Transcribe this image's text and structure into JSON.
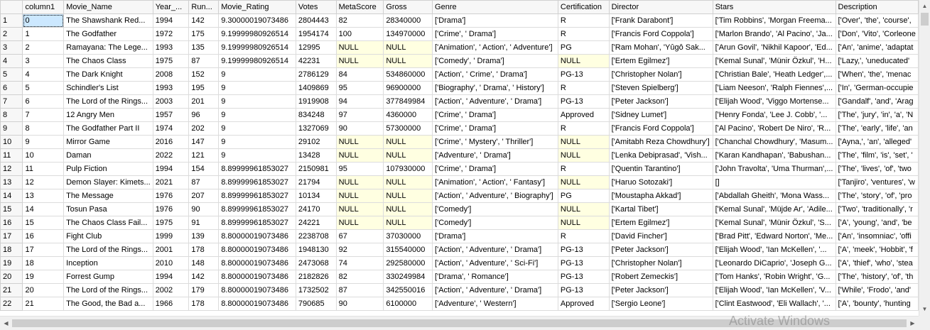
{
  "columns": [
    "",
    "column1",
    "Movie_Name",
    "Year_...",
    "Run...",
    "Movie_Rating",
    "Votes",
    "MetaScore",
    "Gross",
    "Genre",
    "Certification",
    "Director",
    "Stars",
    "Description"
  ],
  "rows": [
    [
      "1",
      "0",
      "The Shawshank Red...",
      "1994",
      "142",
      "9.30000019073486",
      "2804443",
      "82",
      "28340000",
      "['Drama']",
      "R",
      "['Frank Darabont']",
      "['Tim Robbins', 'Morgan Freema...",
      "['Over', 'the', 'course',"
    ],
    [
      "2",
      "1",
      "The Godfather",
      "1972",
      "175",
      "9.19999980926514",
      "1954174",
      "100",
      "134970000",
      "['Crime', ' Drama']",
      "R",
      "['Francis Ford Coppola']",
      "['Marlon Brando', 'Al Pacino', 'Ja...",
      "['Don', 'Vito', 'Corleone"
    ],
    [
      "3",
      "2",
      "Ramayana: The Lege...",
      "1993",
      "135",
      "9.19999980926514",
      "12995",
      "NULL",
      "NULL",
      "['Animation', ' Action', ' Adventure']",
      "PG",
      "['Ram Mohan', 'Yûgô Sak...",
      "['Arun Govil', 'Nikhil Kapoor', 'Ed...",
      "['An', 'anime', 'adaptat"
    ],
    [
      "4",
      "3",
      "The Chaos Class",
      "1975",
      "87",
      "9.19999980926514",
      "42231",
      "NULL",
      "NULL",
      "['Comedy', ' Drama']",
      "NULL",
      "['Ertem Egilmez']",
      "['Kemal Sunal', 'Münir Özkul', 'H...",
      "['Lazy,', 'uneducated'"
    ],
    [
      "5",
      "4",
      "The Dark Knight",
      "2008",
      "152",
      "9",
      "2786129",
      "84",
      "534860000",
      "['Action', ' Crime', ' Drama']",
      "PG-13",
      "['Christopher Nolan']",
      "['Christian Bale', 'Heath Ledger',...",
      "['When', 'the', 'menac"
    ],
    [
      "6",
      "5",
      "Schindler's List",
      "1993",
      "195",
      "9",
      "1409869",
      "95",
      "96900000",
      "['Biography', ' Drama', ' History']",
      "R",
      "['Steven Spielberg']",
      "['Liam Neeson', 'Ralph Fiennes',...",
      "['In', 'German-occupie"
    ],
    [
      "7",
      "6",
      "The Lord of the Rings...",
      "2003",
      "201",
      "9",
      "1919908",
      "94",
      "377849984",
      "['Action', ' Adventure', ' Drama']",
      "PG-13",
      "['Peter Jackson']",
      "['Elijah Wood', 'Viggo Mortense...",
      "['Gandalf', 'and', 'Arag"
    ],
    [
      "8",
      "7",
      "12 Angry Men",
      "1957",
      "96",
      "9",
      "834248",
      "97",
      "4360000",
      "['Crime', ' Drama']",
      "Approved",
      "['Sidney Lumet']",
      "['Henry Fonda', 'Lee J. Cobb', '...",
      "['The', 'jury', 'in', 'a', 'N"
    ],
    [
      "9",
      "8",
      "The Godfather Part II",
      "1974",
      "202",
      "9",
      "1327069",
      "90",
      "57300000",
      "['Crime', ' Drama']",
      "R",
      "['Francis Ford Coppola']",
      "['Al Pacino', 'Robert De Niro', 'R...",
      "['The', 'early', 'life', 'an"
    ],
    [
      "10",
      "9",
      "Mirror Game",
      "2016",
      "147",
      "9",
      "29102",
      "NULL",
      "NULL",
      "['Crime', ' Mystery', ' Thriller']",
      "NULL",
      "['Amitabh Reza Chowdhury']",
      "['Chanchal Chowdhury', 'Masum...",
      "['Ayna,', 'an', 'alleged'"
    ],
    [
      "11",
      "10",
      "Daman",
      "2022",
      "121",
      "9",
      "13428",
      "NULL",
      "NULL",
      "['Adventure', ' Drama']",
      "NULL",
      "['Lenka Debiprasad', 'Vish...",
      "['Karan Kandhapan', 'Babushan...",
      "['The', 'film', 'is', 'set', '"
    ],
    [
      "12",
      "11",
      "Pulp Fiction",
      "1994",
      "154",
      "8.89999961853027",
      "2150981",
      "95",
      "107930000",
      "['Crime', ' Drama']",
      "R",
      "['Quentin Tarantino']",
      "['John Travolta', 'Uma Thurman',...",
      "['The', 'lives', 'of', 'two"
    ],
    [
      "13",
      "12",
      "Demon Slayer: Kimets...",
      "2021",
      "87",
      "8.89999961853027",
      "21794",
      "NULL",
      "NULL",
      "['Animation', ' Action', ' Fantasy']",
      "NULL",
      "['Haruo Sotozaki']",
      "[]",
      "['Tanjiro', 'ventures', 'w"
    ],
    [
      "14",
      "13",
      "The Message",
      "1976",
      "207",
      "8.89999961853027",
      "10134",
      "NULL",
      "NULL",
      "['Action', ' Adventure', ' Biography']",
      "PG",
      "['Moustapha Akkad']",
      "['Abdallah Gheith', 'Mona Wass...",
      "['The', 'story', 'of', 'pro"
    ],
    [
      "15",
      "14",
      "Tosun Pasa",
      "1976",
      "90",
      "8.89999961853027",
      "24170",
      "NULL",
      "NULL",
      "['Comedy']",
      "NULL",
      "['Kartal Tibet']",
      "['Kemal Sunal', 'Müjde Ar', 'Adile...",
      "['Two', 'traditionally', 'r"
    ],
    [
      "16",
      "15",
      "The Chaos Class Fail...",
      "1975",
      "91",
      "8.89999961853027",
      "24221",
      "NULL",
      "NULL",
      "['Comedy']",
      "NULL",
      "['Ertem Egilmez']",
      "['Kemal Sunal', 'Münir Özkul', 'S...",
      "['A', 'young', 'and', 'be"
    ],
    [
      "17",
      "16",
      "Fight Club",
      "1999",
      "139",
      "8.80000019073486",
      "2238708",
      "67",
      "37030000",
      "['Drama']",
      "R",
      "['David Fincher']",
      "['Brad Pitt', 'Edward Norton', 'Me...",
      "['An', 'insomniac', 'offi"
    ],
    [
      "18",
      "17",
      "The Lord of the Rings...",
      "2001",
      "178",
      "8.80000019073486",
      "1948130",
      "92",
      "315540000",
      "['Action', ' Adventure', ' Drama']",
      "PG-13",
      "['Peter Jackson']",
      "['Elijah Wood', 'Ian McKellen', '...",
      "['A', 'meek', 'Hobbit', 'f"
    ],
    [
      "19",
      "18",
      "Inception",
      "2010",
      "148",
      "8.80000019073486",
      "2473068",
      "74",
      "292580000",
      "['Action', ' Adventure', ' Sci-Fi']",
      "PG-13",
      "['Christopher Nolan']",
      "['Leonardo DiCaprio', 'Joseph G...",
      "['A', 'thief', 'who', 'stea"
    ],
    [
      "20",
      "19",
      "Forrest Gump",
      "1994",
      "142",
      "8.80000019073486",
      "2182826",
      "82",
      "330249984",
      "['Drama', ' Romance']",
      "PG-13",
      "['Robert Zemeckis']",
      "['Tom Hanks', 'Robin Wright', 'G...",
      "['The', 'history', 'of', 'th"
    ],
    [
      "21",
      "20",
      "The Lord of the Rings...",
      "2002",
      "179",
      "8.80000019073486",
      "1732502",
      "87",
      "342550016",
      "['Action', ' Adventure', ' Drama']",
      "PG-13",
      "['Peter Jackson']",
      "['Elijah Wood', 'Ian McKellen', 'V...",
      "['While', 'Frodo', 'and'"
    ],
    [
      "22",
      "21",
      "The Good, the Bad a...",
      "1966",
      "178",
      "8.80000019073486",
      "790685",
      "90",
      "6100000",
      "['Adventure', ' Western']",
      "Approved",
      "['Sergio Leone']",
      "['Clint Eastwood', 'Eli Wallach', '...",
      "['A', 'bounty', 'hunting"
    ]
  ],
  "watermark": "Activate Windows",
  "colors": {
    "null_background": "#ffffe1",
    "header_background": "#f7f7f7",
    "grid_line": "#dcdcdc",
    "selection": "#cce8ff"
  },
  "icons": {
    "scroll_up": "▲",
    "scroll_down": "▼",
    "scroll_left": "◀",
    "scroll_right": "▶"
  }
}
